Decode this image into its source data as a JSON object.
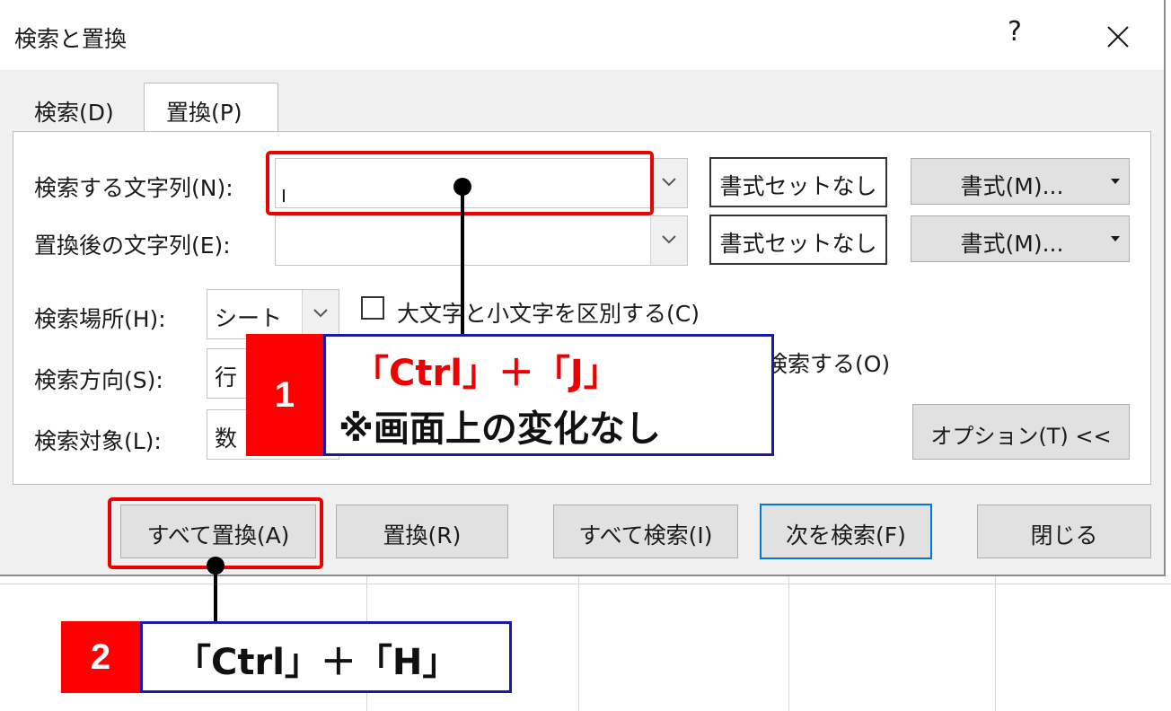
{
  "dialog": {
    "title": "検索と置換",
    "help_label": "?",
    "tabs": {
      "search": "検索(D)",
      "replace": "置換(P)"
    },
    "find_label": "検索する文字列(N):",
    "find_value": "",
    "replace_label": "置換後の文字列(E):",
    "replace_value": "",
    "no_format_button": "書式セットなし",
    "format_button": "書式(M)...",
    "within_label": "検索場所(H):",
    "within_value": "シート",
    "search_label": "検索方向(S):",
    "search_value": "行",
    "lookin_label": "検索対象(L):",
    "lookin_value": "数",
    "match_case_label": "大文字と小文字を区別する(C)",
    "match_entire_label_partial": "検索する(O)",
    "options_button": "オプション(T) <<",
    "buttons": {
      "replace_all": "すべて置換(A)",
      "replace": "置換(R)",
      "find_all": "すべて検索(I)",
      "find_next": "次を検索(F)",
      "close": "閉じる"
    }
  },
  "annotations": {
    "step1": {
      "number": "1",
      "line1": "「Ctrl」＋「J」",
      "line2": "※画面上の変化なし"
    },
    "step2": {
      "number": "2",
      "text": "「Ctrl」＋「H」"
    }
  },
  "colors": {
    "highlight_red": "#ee0000",
    "callout_border": "#1a1aa8",
    "focus_blue": "#0078d7"
  }
}
